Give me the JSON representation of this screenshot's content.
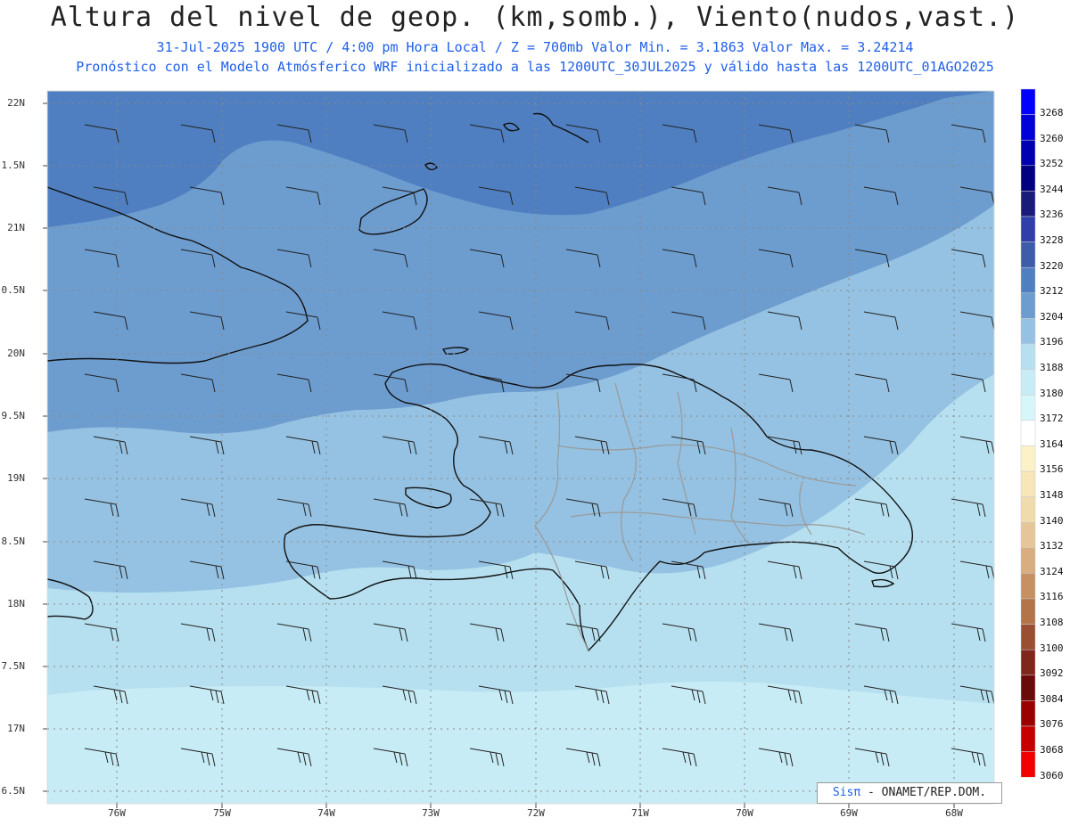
{
  "header": {
    "title": "Altura del nivel de geop. (km,somb.), Viento(nudos,vast.)",
    "line1": "31-Jul-2025   1900 UTC / 4:00 pm Hora Local / Z = 700mb     Valor Min. = 3.1863  Valor Max. = 3.24214",
    "line2": "Pronóstico con el Modelo Atmósferico WRF inicializado a las 1200UTC_30JUL2025 y válido hasta las  1200UTC_01AGO2025"
  },
  "axes": {
    "lat_labels": [
      "22N",
      "1.5N",
      "21N",
      "0.5N",
      "20N",
      "9.5N",
      "19N",
      "8.5N",
      "18N",
      "7.5N",
      "17N",
      "6.5N"
    ],
    "lon_labels": [
      "76W",
      "75W",
      "74W",
      "73W",
      "72W",
      "71W",
      "70W",
      "69W",
      "68W"
    ]
  },
  "colorbar": {
    "labels": [
      "3268",
      "3260",
      "3252",
      "3244",
      "3236",
      "3228",
      "3220",
      "3212",
      "3204",
      "3196",
      "3188",
      "3180",
      "3172",
      "3164",
      "3156",
      "3148",
      "3140",
      "3132",
      "3124",
      "3116",
      "3108",
      "3100",
      "3092",
      "3084",
      "3076",
      "3068",
      "3060"
    ],
    "colors": [
      "#0000ff",
      "#0000d8",
      "#0000b0",
      "#000080",
      "#1a1a7a",
      "#2f3ea8",
      "#3d5da8",
      "#4f7fc0",
      "#6d9ccf",
      "#95c2e2",
      "#b6e0f0",
      "#c7ecf5",
      "#d6f6fa",
      "#ffffff",
      "#fbf2c8",
      "#f6e6b8",
      "#f0dbad",
      "#e6c698",
      "#d8ad7f",
      "#c69062",
      "#b27448",
      "#9a4f33",
      "#80271d",
      "#6a0a0a",
      "#9a0000",
      "#c60000",
      "#f00000"
    ]
  },
  "credit": {
    "sis": "Sisπ",
    "text": " - ONAMET/REP.DOM."
  },
  "colors": {
    "title": "#222222",
    "subtitle": "#1f5fe8",
    "field_dark": "#4f7fc0",
    "field_mid": "#6d9ccf",
    "field_light": "#95c2e2",
    "field_pale": "#b6e0f0",
    "field_palest": "#c7ecf5"
  }
}
